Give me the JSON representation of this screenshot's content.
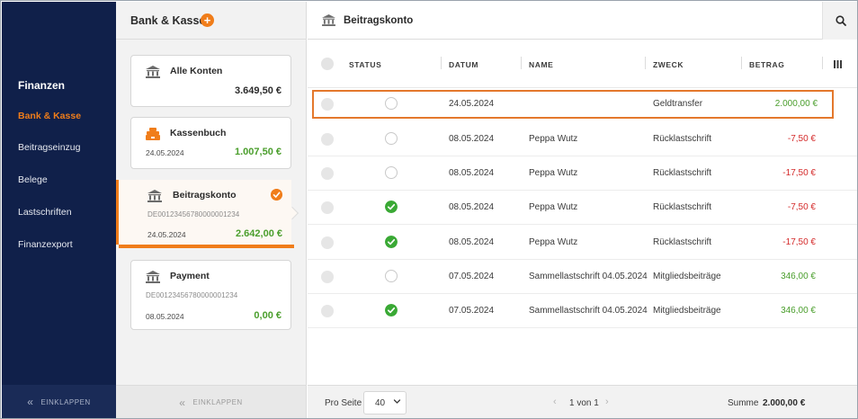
{
  "nav": {
    "section_title": "Finanzen",
    "items": [
      {
        "label": "Bank & Kasse",
        "active": true
      },
      {
        "label": "Beitragseinzug",
        "active": false
      },
      {
        "label": "Belege",
        "active": false
      },
      {
        "label": "Lastschriften",
        "active": false
      },
      {
        "label": "Finanzexport",
        "active": false
      }
    ],
    "collapse_label": "EINKLAPPEN"
  },
  "accounts": {
    "title": "Bank & Kasse",
    "add_label": "+",
    "cards": [
      {
        "name": "Alle Konten",
        "iban": "",
        "date": "",
        "amount": "3.649,50 €",
        "icon": "bank-icon"
      },
      {
        "name": "Kassenbuch",
        "iban": "",
        "date": "24.05.2024",
        "amount": "1.007,50 €",
        "icon": "cashbox-icon"
      },
      {
        "name": "Beitragskonto",
        "iban": "DE00123456780000001234",
        "date": "24.05.2024",
        "amount": "2.642,00 €",
        "icon": "bank-icon",
        "selected": true
      },
      {
        "name": "Payment",
        "iban": "DE00123456780000001234",
        "date": "08.05.2024",
        "amount": "0,00 €",
        "icon": "bank-icon"
      }
    ],
    "collapse_label": "EINKLAPPEN"
  },
  "main": {
    "title": "Beitragskonto",
    "columns": {
      "status": "STATUS",
      "datum": "DATUM",
      "name": "NAME",
      "zweck": "ZWECK",
      "betrag": "BETRAG"
    },
    "rows": [
      {
        "status": "open",
        "datum": "24.05.2024",
        "name": "",
        "zweck": "Geldtransfer",
        "betrag": "2.000,00 €",
        "sign": "pos",
        "highlight": true
      },
      {
        "status": "open",
        "datum": "08.05.2024",
        "name": "Peppa Wutz",
        "zweck": "Rücklastschrift",
        "betrag": "-7,50 €",
        "sign": "neg"
      },
      {
        "status": "open",
        "datum": "08.05.2024",
        "name": "Peppa Wutz",
        "zweck": "Rücklastschrift",
        "betrag": "-17,50 €",
        "sign": "neg"
      },
      {
        "status": "done",
        "datum": "08.05.2024",
        "name": "Peppa Wutz",
        "zweck": "Rücklastschrift",
        "betrag": "-7,50 €",
        "sign": "neg"
      },
      {
        "status": "done",
        "datum": "08.05.2024",
        "name": "Peppa Wutz",
        "zweck": "Rücklastschrift",
        "betrag": "-17,50 €",
        "sign": "neg"
      },
      {
        "status": "open",
        "datum": "07.05.2024",
        "name": "Sammellastschrift 04.05.2024",
        "zweck": "Mitgliedsbeiträge",
        "betrag": "346,00 €",
        "sign": "pos"
      },
      {
        "status": "done",
        "datum": "07.05.2024",
        "name": "Sammellastschrift 04.05.2024",
        "zweck": "Mitgliedsbeiträge",
        "betrag": "346,00 €",
        "sign": "pos"
      }
    ],
    "footer": {
      "per_page_label": "Pro Seite",
      "per_page_value": "40",
      "pagination": "1 von 1",
      "sum_label": "Summe",
      "sum_value": "2.000,00 €"
    }
  },
  "colors": {
    "accent": "#f07d1a",
    "nav_bg": "#10204a",
    "positive": "#4a9e2c",
    "negative": "#d42a2a",
    "status_done": "#3aa935"
  }
}
